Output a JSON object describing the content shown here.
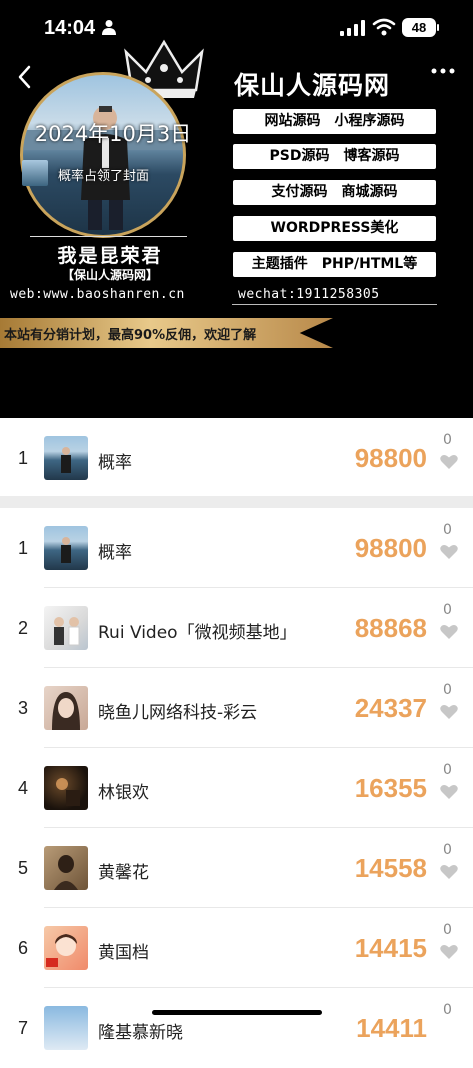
{
  "status_bar": {
    "time": "14:04",
    "battery": "48"
  },
  "banner": {
    "date_text": "2024年10月3日",
    "cover_text": "概率占领了封面",
    "site_title": "保山人源码网",
    "tags": [
      "网站源码　小程序源码",
      "PSD源码　博客源码",
      "支付源码　商城源码",
      "WORDPRESS美化",
      "主题插件　PHP/HTML等"
    ],
    "owner_name": "我是昆荣君",
    "owner_sub": "【保山人源码网】",
    "web": "web:www.baoshanren.cn",
    "wechat": "wechat:1911258305",
    "ribbon": "本站有分销计划，最高90%反佣，欢迎了解"
  },
  "my_rank": {
    "rank": "1",
    "name": "概率",
    "score": "98800",
    "likes": "0"
  },
  "leaderboard": [
    {
      "rank": "1",
      "name": "概率",
      "score": "98800",
      "likes": "0"
    },
    {
      "rank": "2",
      "name": "Rui Video「微视频基地」",
      "score": "88868",
      "likes": "0"
    },
    {
      "rank": "3",
      "name": "晓鱼儿网络科技-彩云",
      "score": "24337",
      "likes": "0"
    },
    {
      "rank": "4",
      "name": "林银欢",
      "score": "16355",
      "likes": "0"
    },
    {
      "rank": "5",
      "name": "黄馨花",
      "score": "14558",
      "likes": "0"
    },
    {
      "rank": "6",
      "name": "黄国档",
      "score": "14415",
      "likes": "0"
    },
    {
      "rank": "7",
      "name": "隆基慕新晓",
      "score": "14411",
      "likes": "0"
    }
  ],
  "colors": {
    "score": "#eba35c",
    "banner_bg": "#000000",
    "gold": "#c9a45c"
  }
}
